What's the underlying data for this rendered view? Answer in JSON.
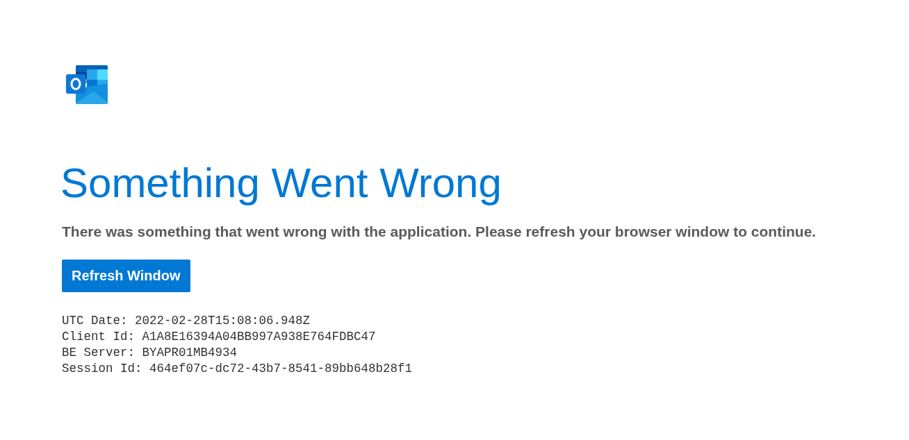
{
  "title": "Something Went Wrong",
  "message": "There was something that went wrong with the application. Please refresh your browser window to continue.",
  "button": "Refresh Window",
  "details": [
    "UTC Date: 2022-02-28T15:08:06.948Z",
    "Client Id: A1A8E16394A04BB997A938E764FDBC47",
    "BE Server: BYAPR01MB4934",
    "Session Id: 464ef07c-dc72-43b7-8541-89bb648b28f1"
  ]
}
